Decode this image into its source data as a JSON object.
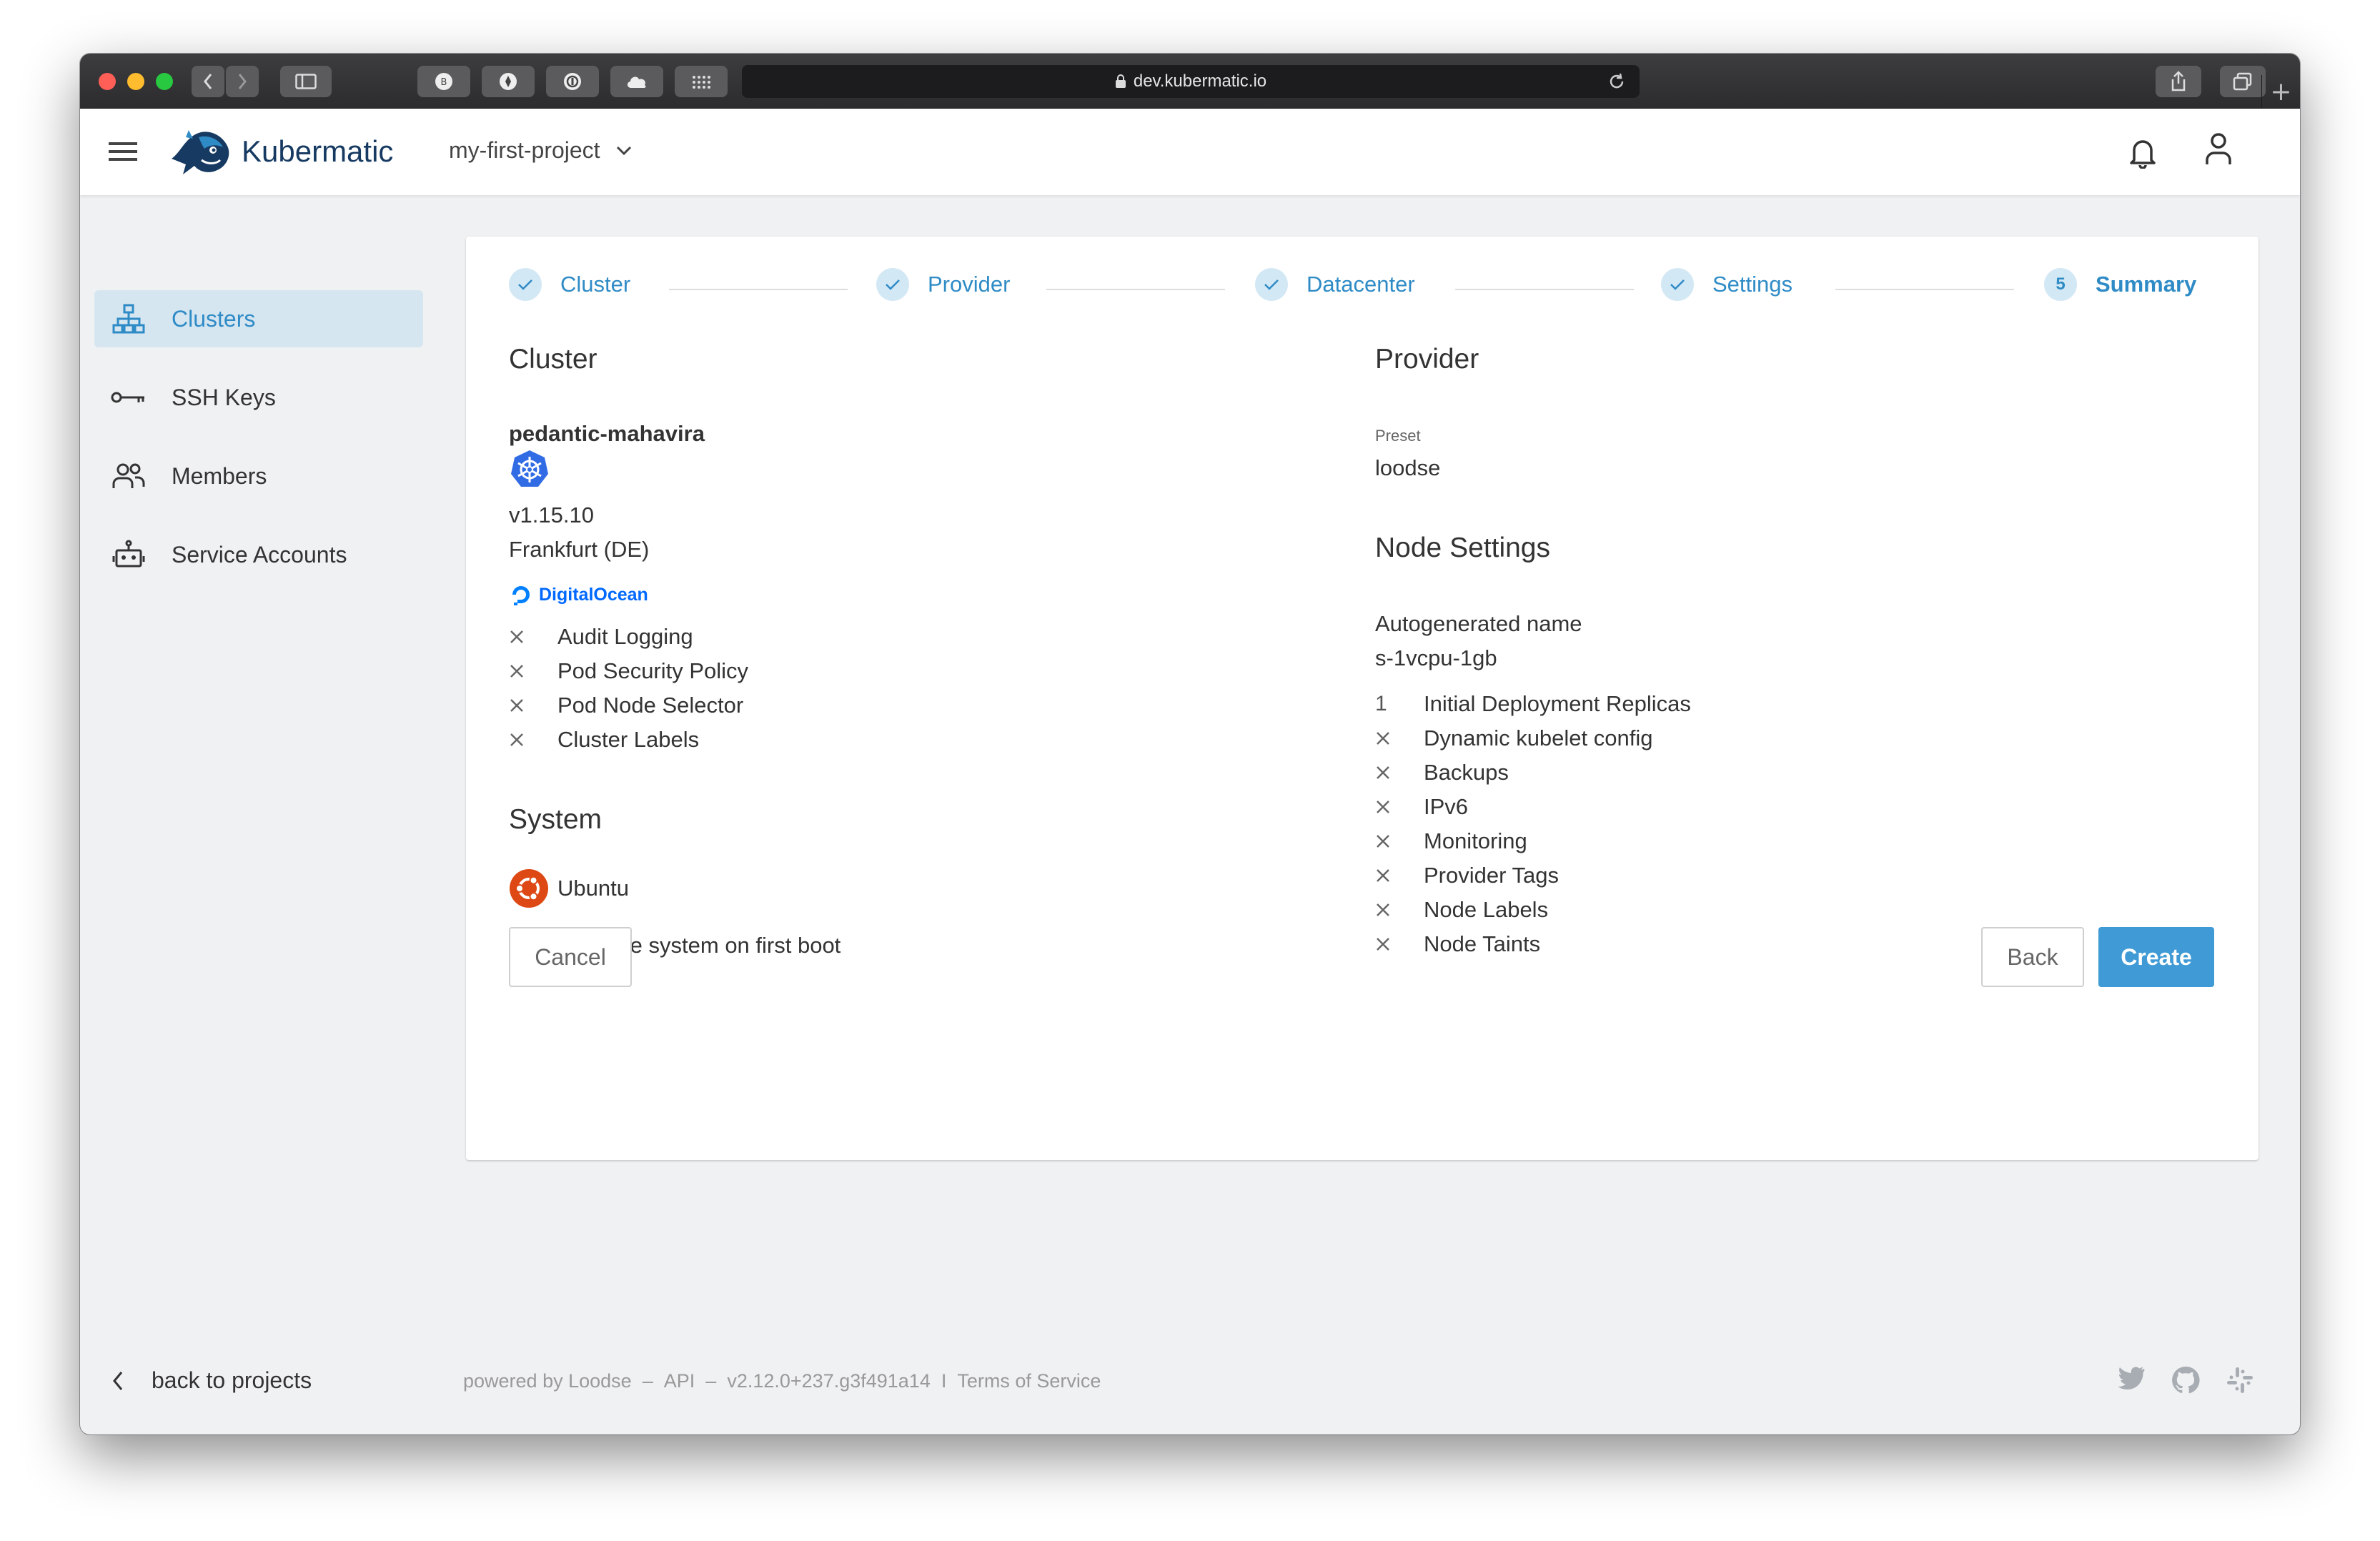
{
  "browser": {
    "url": "dev.kubermatic.io"
  },
  "app": {
    "brand": "Kubermatic",
    "project": "my-first-project"
  },
  "sidebar": {
    "items": [
      {
        "label": "Clusters",
        "icon": "clusters-icon",
        "active": true
      },
      {
        "label": "SSH Keys",
        "icon": "key-icon",
        "active": false
      },
      {
        "label": "Members",
        "icon": "members-icon",
        "active": false
      },
      {
        "label": "Service Accounts",
        "icon": "robot-icon",
        "active": false
      }
    ],
    "back_label": "back to projects"
  },
  "stepper": {
    "steps": [
      {
        "label": "Cluster",
        "state": "done"
      },
      {
        "label": "Provider",
        "state": "done"
      },
      {
        "label": "Datacenter",
        "state": "done"
      },
      {
        "label": "Settings",
        "state": "done"
      },
      {
        "label": "Summary",
        "state": "current",
        "number": "5"
      }
    ]
  },
  "summary": {
    "cluster": {
      "title": "Cluster",
      "name": "pedantic-mahavira",
      "version": "v1.15.10",
      "location": "Frankfurt (DE)",
      "provider_logo_text": "DigitalOcean",
      "options": [
        "Audit Logging",
        "Pod Security Policy",
        "Pod Node Selector",
        "Cluster Labels"
      ]
    },
    "system": {
      "title": "System",
      "os": "Ubuntu",
      "options": [
        "Upgrade system on first boot"
      ]
    },
    "provider": {
      "title": "Provider",
      "preset_label": "Preset",
      "preset_value": "loodse"
    },
    "node_settings": {
      "title": "Node Settings",
      "name_label": "Autogenerated name",
      "size": "s-1vcpu-1gb",
      "replicas_count": "1",
      "replicas_label": "Initial Deployment Replicas",
      "options": [
        "Dynamic kubelet config",
        "Backups",
        "IPv6",
        "Monitoring",
        "Provider Tags",
        "Node Labels",
        "Node Taints"
      ]
    }
  },
  "actions": {
    "cancel": "Cancel",
    "back": "Back",
    "create": "Create"
  },
  "footer": {
    "powered": "powered by Loodse",
    "sep1": "–",
    "api": "API",
    "sep2": "–",
    "version": "v2.12.0+237.g3f491a14",
    "sep3": "I",
    "terms": "Terms of Service"
  },
  "colors": {
    "accent": "#2f8bc6",
    "primary_button": "#3f9ad5",
    "active_nav_bg": "#d6e6f1",
    "brand_text": "#163a61"
  }
}
